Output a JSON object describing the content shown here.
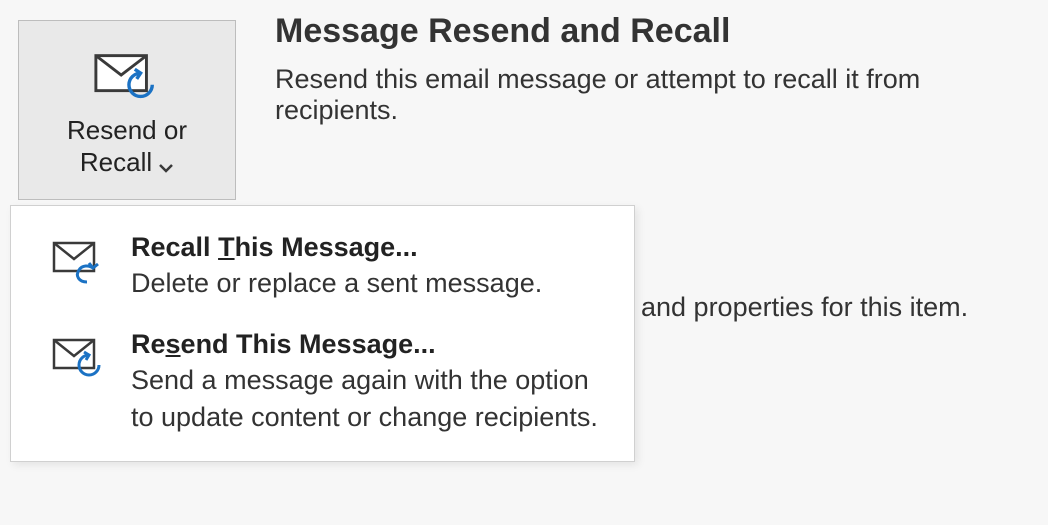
{
  "ribbon_button": {
    "label_line1": "Resend or",
    "label_line2": "Recall"
  },
  "header": {
    "title": "Message Resend and Recall",
    "subtitle": "Resend this email message or attempt to recall it from recipients."
  },
  "background_text": "and properties for this item.",
  "menu": {
    "recall": {
      "title_pre": "Recall ",
      "title_u": "T",
      "title_post": "his Message...",
      "desc": "Delete or replace a sent message."
    },
    "resend": {
      "title_pre": "Re",
      "title_u": "s",
      "title_post": "end This Message...",
      "desc": "Send a message again with the option to update content or change recipients."
    }
  }
}
